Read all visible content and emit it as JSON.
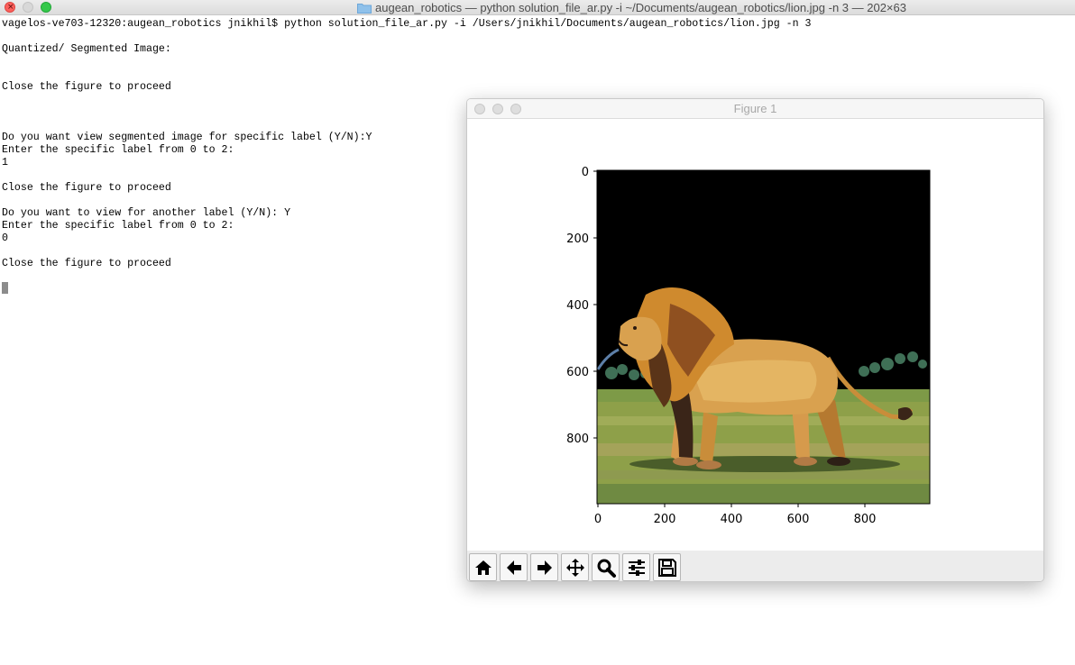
{
  "terminal": {
    "window_title": "augean_robotics — python solution_file_ar.py -i ~/Documents/augean_robotics/lion.jpg -n 3 — 202×63",
    "lines": [
      "vagelos-ve703-12320:augean_robotics jnikhil$ python solution_file_ar.py -i /Users/jnikhil/Documents/augean_robotics/lion.jpg -n 3",
      "",
      "Quantized/ Segmented Image:",
      "",
      "",
      "Close the figure to proceed",
      "",
      "",
      "",
      "Do you want view segmented image for specific label (Y/N):Y",
      "Enter the specific label from 0 to 2:",
      "1",
      "",
      "Close the figure to proceed",
      "",
      "Do you want to view for another label (Y/N): Y",
      "Enter the specific label from 0 to 2:",
      "0",
      "",
      "Close the figure to proceed"
    ]
  },
  "figure": {
    "title": "Figure 1",
    "y_ticks": [
      "0",
      "200",
      "400",
      "600",
      "800"
    ],
    "x_ticks": [
      "0",
      "200",
      "400",
      "600",
      "800"
    ],
    "toolbar": [
      "home-icon",
      "back-icon",
      "forward-icon",
      "pan-icon",
      "zoom-icon",
      "configure-subplots-icon",
      "save-icon"
    ]
  },
  "colors": {
    "close": "#fc605c",
    "maximize": "#34c84a",
    "image_background": "#000000",
    "grass": "#8ea049"
  }
}
